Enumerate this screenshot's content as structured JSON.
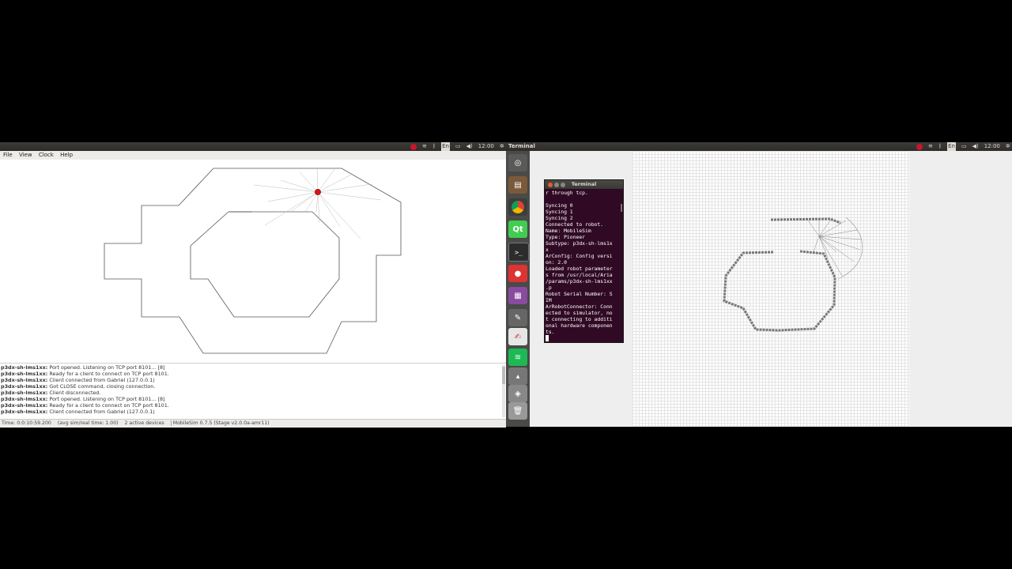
{
  "left_panel": {
    "time": "12:00",
    "kbd": "En"
  },
  "right_panel": {
    "title": "Terminal",
    "time": "12:00",
    "kbd": "En"
  },
  "menu": {
    "file": "File",
    "view": "View",
    "clock": "Clock",
    "help": "Help"
  },
  "log": {
    "lines": [
      {
        "src": "p3dx-sh-lms1xx:",
        "msg": "Port opened. Listening on TCP port 8101... [8]"
      },
      {
        "src": "p3dx-sh-lms1xx:",
        "msg": "Ready for a client to connect on TCP port 8101."
      },
      {
        "src": "p3dx-sh-lms1xx:",
        "msg": "Client connected from Gabriel (127.0.0.1)"
      },
      {
        "src": "p3dx-sh-lms1xx:",
        "msg": "Got CLOSE command, closing connection."
      },
      {
        "src": "p3dx-sh-lms1xx:",
        "msg": "Client disconnected."
      },
      {
        "src": "p3dx-sh-lms1xx:",
        "msg": "Port opened. Listening on TCP port 8101... [8]"
      },
      {
        "src": "p3dx-sh-lms1xx:",
        "msg": "Ready for a client to connect on TCP port 8101."
      },
      {
        "src": "p3dx-sh-lms1xx:",
        "msg": "Client connected from Gabriel (127.0.0.1)"
      }
    ]
  },
  "status": {
    "time": "Time: 0:0:10:59.200",
    "ratio": "(avg sim/real time: 1.00)",
    "devices": "2 active devices",
    "version": "MobileSim 0.7.5 (Stage v2.0.0a-amr11)"
  },
  "terminal": {
    "title": "Terminal",
    "text": "r through tcp.\n\nSyncing 0\nSyncing 1\nSyncing 2\nConnected to robot.\nName: MobileSim\nType: Pioneer\nSubtype: p3dx-sh-lms1x\nx\nArConfig: Config versi\non: 2.0\nLoaded robot parameter\ns from /usr/local/Aria\n/params/p3dx-sh-lms1xx\n.p\nRobot Serial Number: S\nIM\nArRobotConnector: Conn\nected to simulator, no\nt connecting to additi\nonal hardware componen\nts.\n"
  },
  "launcher": {
    "items": [
      {
        "icon": "ubuntu-dash-icon",
        "color": "#5a5a58"
      },
      {
        "icon": "files-icon",
        "color": "#7a5a3a"
      },
      {
        "icon": "chrome-icon",
        "color": "#4285f4"
      },
      {
        "icon": "qt-creator-icon",
        "color": "#41cd52",
        "text": "Qt"
      },
      {
        "icon": "terminal-icon",
        "color": "#2c2c2c",
        "text": ">_"
      },
      {
        "icon": "mobilesim-icon",
        "color": "#c33"
      },
      {
        "icon": "workspace-icon",
        "color": "#8a4aa0"
      },
      {
        "icon": "text-editor-icon",
        "color": "#555"
      },
      {
        "icon": "draw-icon",
        "color": "#d9d9d9"
      },
      {
        "icon": "spotify-icon",
        "color": "#1db954"
      },
      {
        "icon": "vlc-icon",
        "color": "#f08a24"
      }
    ]
  }
}
